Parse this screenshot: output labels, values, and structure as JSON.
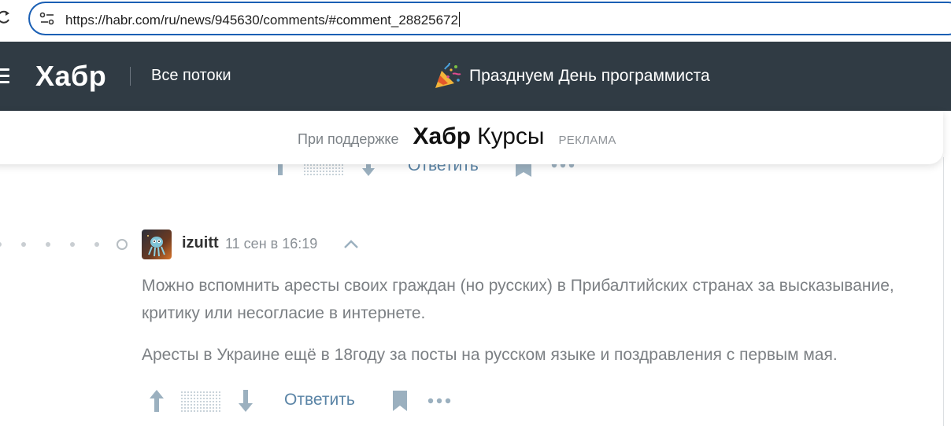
{
  "browser": {
    "url_host": "https://habr.com",
    "url_path": "/ru/news/945630/comments/#comment_28825672"
  },
  "header": {
    "logo": "Хабр",
    "all_flows": "Все потоки",
    "promo_text": "Празднуем День программиста",
    "promo_icon": "party-popper-icon"
  },
  "sponsor": {
    "label": "При поддержке",
    "brand_bold": "Хабр",
    "brand_regular": "Курсы",
    "ad_label": "РЕКЛАМА"
  },
  "previous_comment": {
    "reply_label": "Ответить"
  },
  "comment": {
    "author": "izuitt",
    "time": "11 сен в 16:19",
    "paragraphs": [
      "Можно вспомнить аресты своих граждан (но русских) в Прибалтийских странах за высказывание, критику или несогласие в интернете.",
      "Аресты в Украине ещё в 18году за посты на русском языке и поздравления с первым мая."
    ],
    "reply_label": "Ответить"
  },
  "colors": {
    "header_bg": "#303b44",
    "link": "#5a84a6",
    "vote_icon": "#9bb0bf",
    "focus_ring": "#1a5fb4"
  }
}
